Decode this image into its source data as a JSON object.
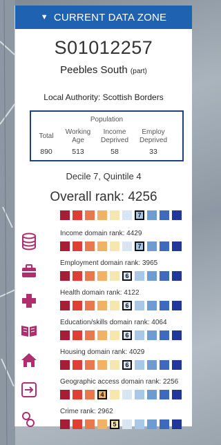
{
  "header": {
    "title": "CURRENT DATA ZONE"
  },
  "zone": {
    "code": "S01012257",
    "name": "Peebles South",
    "name_suffix": "(part)",
    "local_authority": "Local Authority: Scottish Borders"
  },
  "population": {
    "title": "Population",
    "columns": [
      {
        "label": "Total",
        "value": "890"
      },
      {
        "label": "Working Age",
        "value": "513"
      },
      {
        "label": "Income Deprived",
        "value": "58"
      },
      {
        "label": "Employ Deprived",
        "value": "33"
      }
    ]
  },
  "summary": {
    "decile_text": "Decile 7, Quintile 4",
    "overall_text": "Overall rank: 4256",
    "overall_decile": "7"
  },
  "decile_colors": [
    "#a51e36",
    "#de3e34",
    "#e8794e",
    "#f0b365",
    "#f6e7b0",
    "#d7e6f2",
    "#a9c8e5",
    "#6f9bd3",
    "#3e69bd",
    "#22379a"
  ],
  "domains": [
    {
      "label": "Income domain rank: 4429",
      "decile": 7,
      "icon": "database-icon"
    },
    {
      "label": "Employment domain rank: 3965",
      "decile": 6,
      "icon": "briefcase-icon"
    },
    {
      "label": "Health domain rank: 4122",
      "decile": 6,
      "icon": "health-cross-icon"
    },
    {
      "label": "Education/skills domain rank: 4064",
      "decile": 6,
      "icon": "open-book-icon"
    },
    {
      "label": "Housing domain rank: 4029",
      "decile": 6,
      "icon": "house-icon"
    },
    {
      "label": "Geographic access domain rank: 2256",
      "decile": 4,
      "icon": "sign-in-arrow-icon"
    },
    {
      "label": "Crime rank: 2962",
      "decile": 5,
      "icon": "handcuffs-icon"
    }
  ],
  "icon_color": "#b02d6e"
}
